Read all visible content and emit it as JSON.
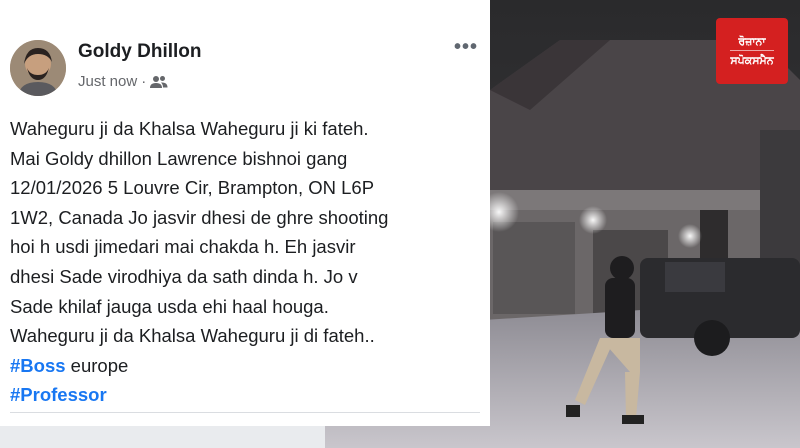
{
  "post": {
    "author": "Goldy Dhillon",
    "timestamp": "Just now",
    "separator": "·",
    "audience_icon": "friends-icon",
    "more_label": "•••",
    "lines": [
      "Waheguru ji da Khalsa Waheguru ji ki fateh.",
      "Mai Goldy dhillon Lawrence bishnoi gang",
      "12/01/2026 5 Louvre Cir, Brampton, ON L6P",
      "1W2, Canada Jo jasvir dhesi de ghre shooting",
      "hoi h usdi jimedari mai chakda h. Eh jasvir",
      "dhesi Sade virodhiya da sath dinda h. Jo v",
      "Sade khilaf jauga usda ehi haal houga.",
      "Waheguru ji da Khalsa Waheguru ji di fateh.."
    ],
    "hashtag1": "#Boss",
    "hashtag1_suffix": " europe",
    "hashtag2": "#Professor"
  },
  "logo": {
    "line1": "ਰੋਜ਼ਾਨਾ",
    "line2": "ਸਪੋਕਸਮੈਨ"
  },
  "colors": {
    "hashtag": "#1877f2",
    "logo_bg": "#d42020",
    "card_bg": "#ffffff"
  }
}
